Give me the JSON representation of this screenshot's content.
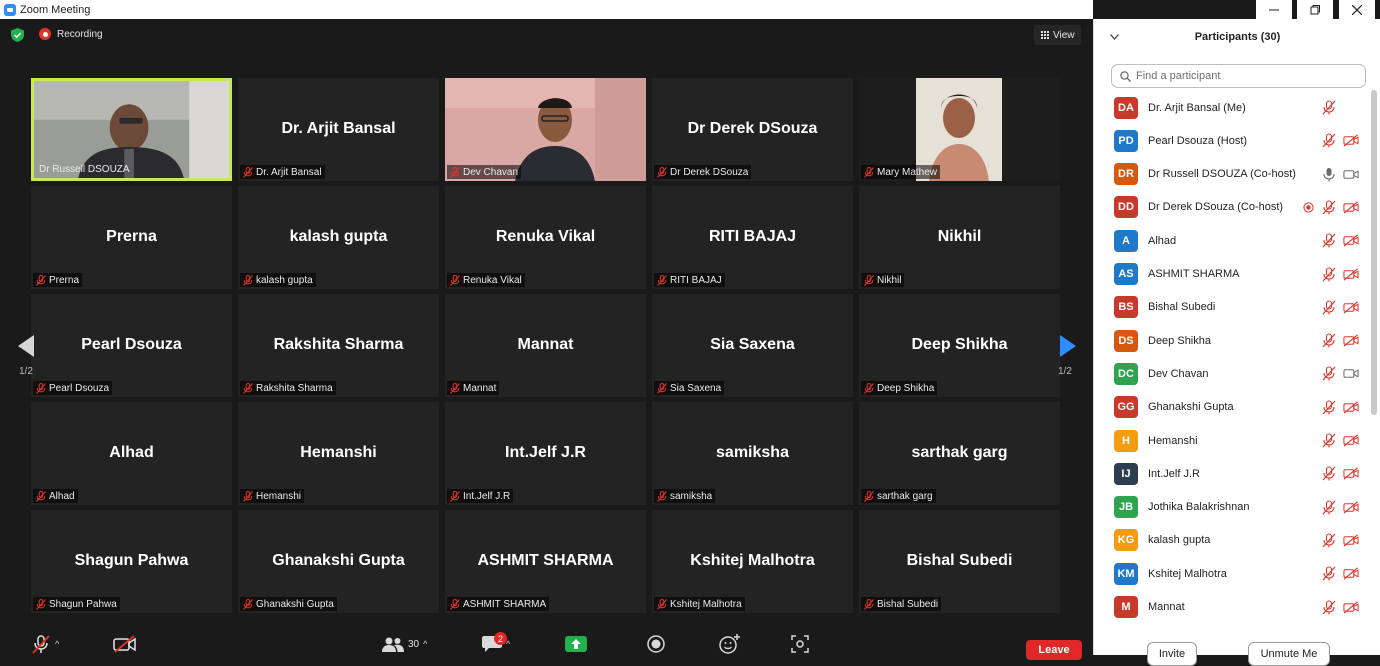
{
  "window": {
    "title": "Zoom Meeting"
  },
  "topbar": {
    "recording_label": "Recording",
    "view_label": "View"
  },
  "pagination": {
    "left": "1/2",
    "right": "1/2"
  },
  "grid": [
    {
      "big": "",
      "tag": "Dr Russell DSOUZA",
      "video": "russell",
      "active": true
    },
    {
      "big": "Dr. Arjit Bansal",
      "tag": "Dr. Arjit Bansal"
    },
    {
      "big": "",
      "tag": "Dev Chavan",
      "video": "dev"
    },
    {
      "big": "Dr Derek DSouza",
      "tag": "Dr Derek DSouza"
    },
    {
      "big": "",
      "tag": "Mary Mathew",
      "video": "mary"
    },
    {
      "big": "Prerna",
      "tag": "Prerna"
    },
    {
      "big": "kalash gupta",
      "tag": "kalash gupta"
    },
    {
      "big": "Renuka Vikal",
      "tag": "Renuka Vikal"
    },
    {
      "big": "RITI BAJAJ",
      "tag": "RITI BAJAJ"
    },
    {
      "big": "Nikhil",
      "tag": "Nikhil"
    },
    {
      "big": "Pearl Dsouza",
      "tag": "Pearl Dsouza"
    },
    {
      "big": "Rakshita Sharma",
      "tag": "Rakshita Sharma"
    },
    {
      "big": "Mannat",
      "tag": "Mannat"
    },
    {
      "big": "Sia Saxena",
      "tag": "Sia Saxena"
    },
    {
      "big": "Deep Shikha",
      "tag": "Deep Shikha"
    },
    {
      "big": "Alhad",
      "tag": "Alhad"
    },
    {
      "big": "Hemanshi",
      "tag": "Hemanshi"
    },
    {
      "big": "Int.Jelf J.R",
      "tag": "Int.Jelf J.R"
    },
    {
      "big": "samiksha",
      "tag": "samiksha"
    },
    {
      "big": "sarthak garg",
      "tag": "sarthak garg"
    },
    {
      "big": "Shagun Pahwa",
      "tag": "Shagun Pahwa"
    },
    {
      "big": "Ghanakshi Gupta",
      "tag": "Ghanakshi Gupta"
    },
    {
      "big": "ASHMIT SHARMA",
      "tag": "ASHMIT SHARMA"
    },
    {
      "big": "Kshitej Malhotra",
      "tag": "Kshitej Malhotra"
    },
    {
      "big": "Bishal Subedi",
      "tag": "Bishal Subedi"
    }
  ],
  "toolbar": {
    "participants_count": "30",
    "chat_badge": "2",
    "leave_label": "Leave"
  },
  "panel": {
    "title": "Participants (30)",
    "search_placeholder": "Find a participant",
    "invite_label": "Invite",
    "unmute_label": "Unmute Me",
    "participants": [
      {
        "initials": "DA",
        "name": "Dr. Arjit Bansal (Me)",
        "color": "#c8392b",
        "mic": "muted",
        "video": "none"
      },
      {
        "initials": "PD",
        "name": "Pearl Dsouza (Host)",
        "color": "#1f78c8",
        "mic": "muted",
        "video": "off"
      },
      {
        "initials": "DR",
        "name": "Dr Russell DSOUZA (Co-host)",
        "color": "#d55a0f",
        "mic": "on",
        "video": "on"
      },
      {
        "initials": "DD",
        "name": "Dr Derek DSouza (Co-host)",
        "color": "#c8392b",
        "mic": "muted",
        "video": "off",
        "rec": true
      },
      {
        "initials": "A",
        "name": "Alhad",
        "color": "#1f78c8",
        "mic": "muted",
        "video": "off"
      },
      {
        "initials": "AS",
        "name": "ASHMIT SHARMA",
        "color": "#1f78c8",
        "mic": "muted",
        "video": "off"
      },
      {
        "initials": "BS",
        "name": "Bishal Subedi",
        "color": "#c8392b",
        "mic": "muted",
        "video": "off"
      },
      {
        "initials": "DS",
        "name": "Deep Shikha",
        "color": "#d55a0f",
        "mic": "muted",
        "video": "off"
      },
      {
        "initials": "DC",
        "name": "Dev Chavan",
        "color": "#2ea44f",
        "mic": "muted",
        "video": "on"
      },
      {
        "initials": "GG",
        "name": "Ghanakshi Gupta",
        "color": "#c8392b",
        "mic": "muted",
        "video": "off"
      },
      {
        "initials": "H",
        "name": "Hemanshi",
        "color": "#f39c12",
        "mic": "muted",
        "video": "off"
      },
      {
        "initials": "IJ",
        "name": "Int.Jelf J.R",
        "color": "#2c3e50",
        "mic": "muted",
        "video": "off"
      },
      {
        "initials": "JB",
        "name": "Jothika Balakrishnan",
        "color": "#2ea44f",
        "mic": "muted",
        "video": "off"
      },
      {
        "initials": "KG",
        "name": "kalash gupta",
        "color": "#f39c12",
        "mic": "muted",
        "video": "off"
      },
      {
        "initials": "KM",
        "name": "Kshitej Malhotra",
        "color": "#1f78c8",
        "mic": "muted",
        "video": "off"
      },
      {
        "initials": "M",
        "name": "Mannat",
        "color": "#c8392b",
        "mic": "muted",
        "video": "off"
      }
    ]
  },
  "colors": {
    "muted_red": "#e0342a",
    "active_border": "#c7e85a",
    "zoom_blue": "#2d8cff"
  }
}
